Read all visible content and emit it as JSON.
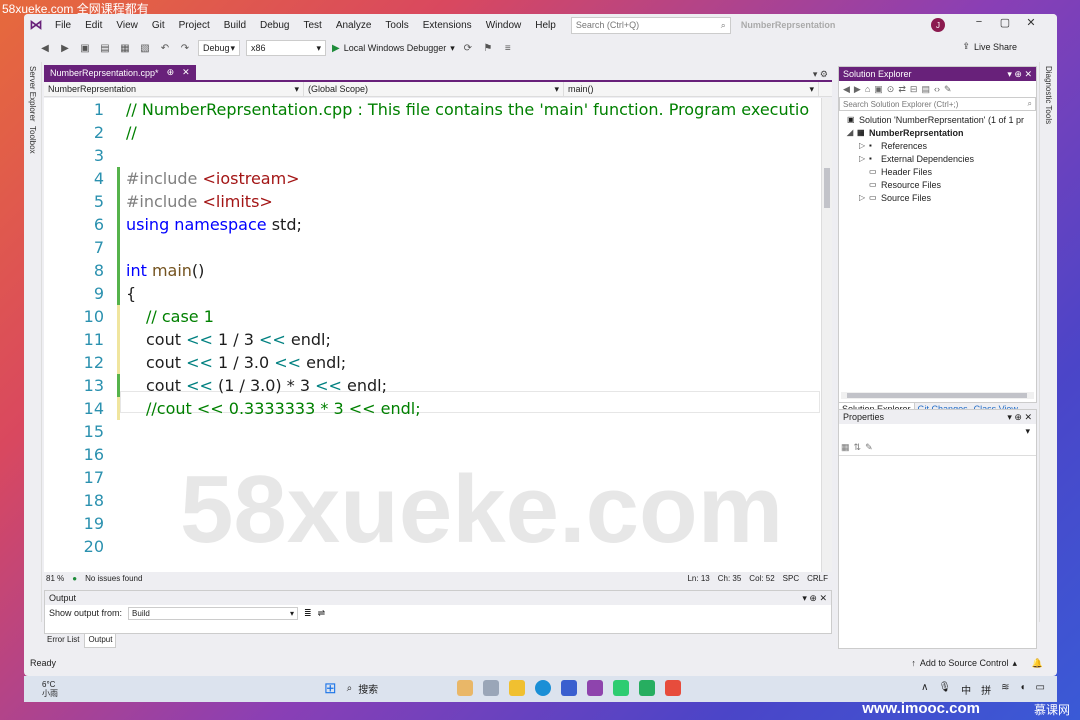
{
  "watermark_top": "58xueke.com 全网课程都有",
  "menu": [
    "File",
    "Edit",
    "View",
    "Git",
    "Project",
    "Build",
    "Debug",
    "Test",
    "Analyze",
    "Tools",
    "Extensions",
    "Window",
    "Help"
  ],
  "search": {
    "placeholder": "Search (Ctrl+Q)"
  },
  "solution_name": "NumberReprsentation",
  "avatar_letter": "J",
  "toolbar": {
    "config": "Debug",
    "platform": "x86",
    "run_label": "Local Windows Debugger",
    "live_share": "Live Share"
  },
  "left_rail": [
    "Server Explorer",
    "Toolbox"
  ],
  "right_rail": [
    "Diagnostic Tools"
  ],
  "doc_tab": {
    "label": "NumberReprsentation.cpp*",
    "pin": "⊕",
    "close": "✕"
  },
  "nav": {
    "project": "NumberReprsentation",
    "scope": "(Global Scope)",
    "member": "main()"
  },
  "code_lines": [
    {
      "n": "1"
    },
    {
      "n": "2"
    },
    {
      "n": "3"
    },
    {
      "n": "4"
    },
    {
      "n": "5"
    },
    {
      "n": "6"
    },
    {
      "n": "7"
    },
    {
      "n": "8"
    },
    {
      "n": "9"
    },
    {
      "n": "10"
    },
    {
      "n": "11"
    },
    {
      "n": "12"
    },
    {
      "n": "13"
    },
    {
      "n": "14"
    },
    {
      "n": "15"
    },
    {
      "n": "16"
    },
    {
      "n": "17"
    },
    {
      "n": "18"
    },
    {
      "n": "19"
    },
    {
      "n": "20"
    }
  ],
  "code": {
    "l1": "// NumberReprsentation.cpp : This file contains the 'main' function. Program executio",
    "l2": "//",
    "l4_pp": "#include ",
    "l4_inc": "<iostream>",
    "l5_pp": "#include ",
    "l5_inc": "<limits>",
    "l6_kw": "using namespace",
    "l6_rest": " std;",
    "l8_kw": "int",
    "l8_fn": " main",
    "l8_rest": "()",
    "l9": "{",
    "l10": "// case 1",
    "l11_a": "cout ",
    "l11_op": "<<",
    "l11_b": " 1 / 3 ",
    "l11_op2": "<<",
    "l11_c": " endl;",
    "l12_a": "cout ",
    "l12_op": "<<",
    "l12_b": " 1 / 3.0 ",
    "l12_op2": "<<",
    "l12_c": " endl;",
    "l13_a": "cout ",
    "l13_op": "<<",
    "l13_b": " (1 / 3.0) * 3 ",
    "l13_op2": "<<",
    "l13_c": " endl;",
    "l14": "//cout << 0.3333333 * 3 << endl;"
  },
  "editor_status": {
    "zoom": "81 %",
    "issues": "No issues found",
    "ln": "Ln: 13",
    "ch": "Ch: 35",
    "col": "Col: 52",
    "spc": "SPC",
    "crlf": "CRLF"
  },
  "output": {
    "title": "Output",
    "show_from_label": "Show output from:",
    "show_from_value": "Build",
    "tabs": [
      "Error List",
      "Output"
    ]
  },
  "solution_explorer": {
    "title": "Solution Explorer",
    "search_placeholder": "Search Solution Explorer (Ctrl+;)",
    "solution": "Solution 'NumberReprsentation' (1 of 1 pr",
    "project": "NumberReprsentation",
    "items": [
      "References",
      "External Dependencies",
      "Header Files",
      "Resource Files",
      "Source Files"
    ],
    "tabs": [
      "Solution Explorer",
      "Git Changes",
      "Class View"
    ]
  },
  "properties": {
    "title": "Properties"
  },
  "status": {
    "ready": "Ready",
    "add_source": "Add to Source Control"
  },
  "taskbar": {
    "temp": "6°C",
    "weather": "小雨",
    "search": "搜索",
    "lang1": "中",
    "lang2": "拼"
  },
  "big_watermark": "58xueke.com",
  "bottom_watermark": "www.imooc.com",
  "bottom_logo": "慕课网",
  "colors": {
    "accent": "#68217a",
    "comment": "#008000",
    "keyword": "#0000ff",
    "line_number": "#2b91af"
  }
}
